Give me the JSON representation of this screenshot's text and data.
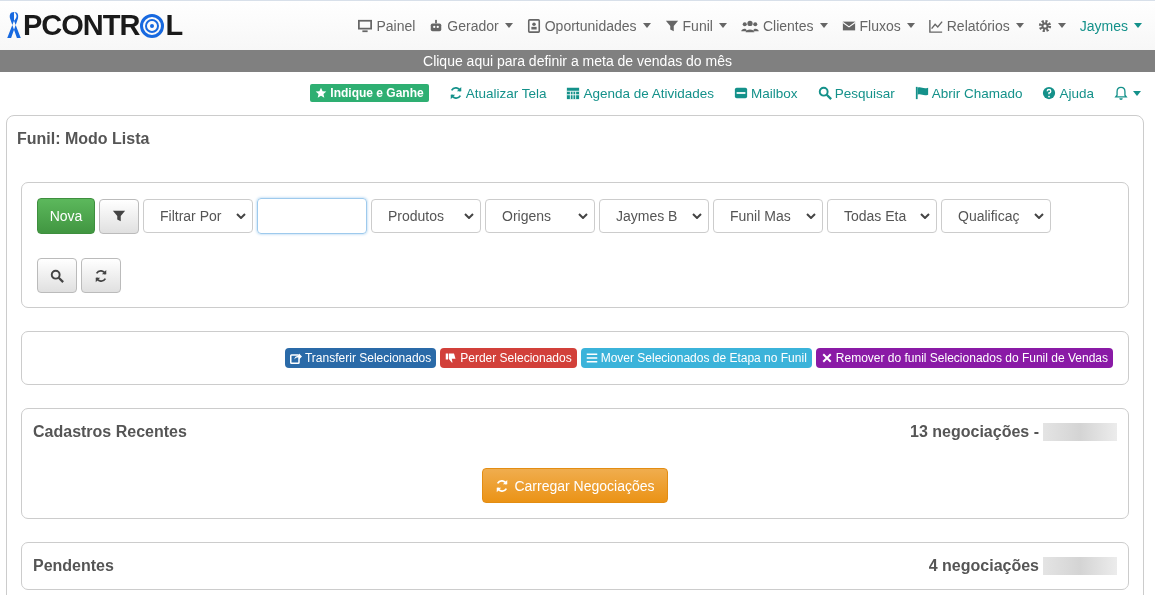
{
  "logo": {
    "parts": [
      "PCONTR",
      "L"
    ]
  },
  "nav": [
    {
      "label": "Painel",
      "caret": false
    },
    {
      "label": "Gerador",
      "caret": true
    },
    {
      "label": "Oportunidades",
      "caret": true
    },
    {
      "label": "Funil",
      "caret": true
    },
    {
      "label": "Clientes",
      "caret": true
    },
    {
      "label": "Fluxos",
      "caret": true
    },
    {
      "label": "Relatórios",
      "caret": true
    },
    {
      "caret": true
    },
    {
      "label": "Jaymes",
      "caret": true
    }
  ],
  "banner": "Clique aqui para definir a meta de vendas do mês",
  "toolbar": {
    "badge": "Indique e Ganhe",
    "links": [
      "Atualizar Tela",
      "Agenda de Atividades",
      "Mailbox",
      "Pesquisar",
      "Abrir Chamado",
      "Ajuda"
    ]
  },
  "page_title": "Funil: Modo Lista",
  "filters": {
    "new_button": "Nova",
    "selects": [
      "Filtrar Por",
      "Produtos",
      "Origens",
      "Jaymes B",
      "Funil Mas",
      "Todas Eta",
      "Qualificaç"
    ]
  },
  "actions": [
    {
      "label": "Transferir Selecionados",
      "color": "#2a6aa8"
    },
    {
      "label": "Perder Selecionados",
      "color": "#d2403a"
    },
    {
      "label": "Mover Selecionados de Etapa no Funil",
      "color": "#3bb3da"
    },
    {
      "label": "Remover do funil Selecionados do Funil de Vendas",
      "color": "#8a1aa6"
    }
  ],
  "sections": [
    {
      "title": "Cadastros Recentes",
      "count": "13 negociações -",
      "button": "Carregar Negociações"
    },
    {
      "title": "Pendentes",
      "count": "4 negociações"
    }
  ]
}
